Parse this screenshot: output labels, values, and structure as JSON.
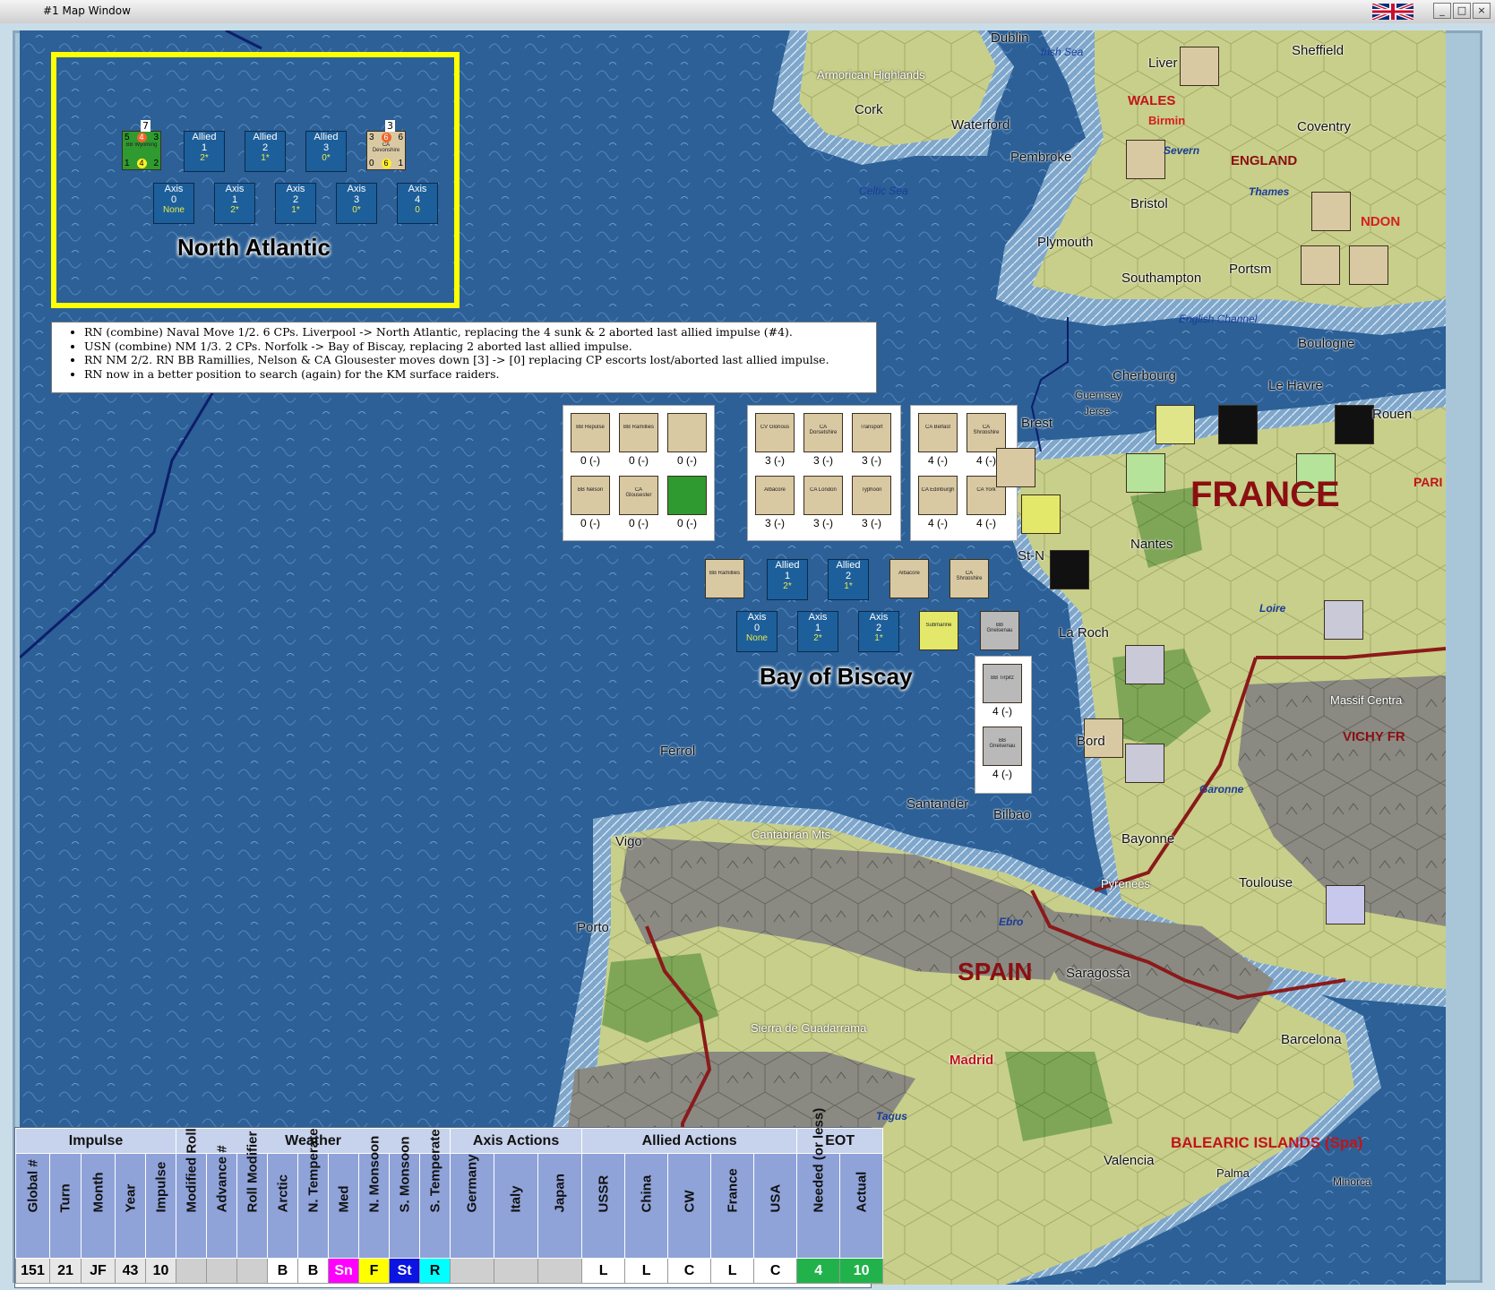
{
  "window": {
    "title": "#1 Map Window"
  },
  "map": {
    "seas": {
      "north_atlantic": "North Atlantic",
      "bay_of_biscay": "Bay of Biscay",
      "irish_sea": "Irish Sea",
      "celtic_sea": "Celtic Sea",
      "english_channel": "English Channel"
    },
    "cities": [
      "Dublin",
      "Cork",
      "Waterford",
      "Liver",
      "Sheffield",
      "Coventry",
      "Pembroke",
      "Bristol",
      "Plymouth",
      "Southampton",
      "Portsm",
      "Boulogne",
      "Cherbourg",
      "Le Havre",
      "Guernsey",
      "Jerse",
      "Brest",
      "Nantes",
      "St-N",
      "La Roch",
      "Bord",
      "Ferrol",
      "Vigo",
      "Porto",
      "Santander",
      "Bilbao",
      "Bayonne",
      "Toulouse",
      "Saragossa",
      "Barcelona",
      "Madrid",
      "Valencia",
      "Palma",
      "Minorca",
      "PARI",
      "Rouen"
    ],
    "regions": {
      "armorican": "Armorican Highlands",
      "cantabrian": "Cantabrian Mts",
      "pyrenees": "Pyrenees",
      "guadarrama": "Sierra de Guadarrama",
      "massif": "Massif Centra",
      "vichy": "VICHY FR"
    },
    "rivers": {
      "severn": "Severn",
      "thames": "Thames",
      "loire": "Loire",
      "garonne": "Garonne",
      "ebro": "Ebro",
      "tagus": "Tagus"
    },
    "countries": {
      "france": "FRANCE",
      "spain": "SPAIN",
      "england": "ENGLAND",
      "wales": "WALES",
      "london": "NDON",
      "birmingham": "Birmin",
      "balearic": "BALEARIC ISLANDS (Spa)"
    }
  },
  "north_atlantic_box": {
    "allied": [
      {
        "label": "Allied",
        "n": "1",
        "v": "2*"
      },
      {
        "label": "Allied",
        "n": "2",
        "v": "1*"
      },
      {
        "label": "Allied",
        "n": "3",
        "v": "0*"
      }
    ],
    "axis": [
      {
        "label": "Axis",
        "n": "0",
        "v": "None"
      },
      {
        "label": "Axis",
        "n": "1",
        "v": "2*"
      },
      {
        "label": "Axis",
        "n": "2",
        "v": "1*"
      },
      {
        "label": "Axis",
        "n": "3",
        "v": "0*"
      },
      {
        "label": "Axis",
        "n": "4",
        "v": "0"
      }
    ],
    "units": [
      {
        "name": "BB Wyoming",
        "stack": "7",
        "tl": "5",
        "tm": "4",
        "tr": "3",
        "bl": "1",
        "bm": "4",
        "br": "2"
      },
      {
        "name": "CA Devonshire",
        "stack": "3",
        "tl": "3",
        "tm": "6",
        "tr": "6",
        "bl": "0",
        "bm": "6",
        "br": "1"
      }
    ]
  },
  "notes": [
    "RN (combine) Naval Move 1/2.  6 CPs.  Liverpool -> North Atlantic, replacing the 4 sunk & 2 aborted last allied impulse (#4).",
    "USN (combine) NM 1/3.  2 CPs.  Norfolk -> Bay of Biscay, replacing 2 aborted last allied impulse.",
    "RN NM 2/2.  RN BB Ramillies, Nelson & CA Glousester moves down [3] -> [0] replacing CP escorts lost/aborted last allied impulse.",
    "RN now in a better position to search (again) for the KM surface raiders."
  ],
  "biscay_box": {
    "allied": [
      {
        "label": "Allied",
        "n": "1",
        "v": "2*"
      },
      {
        "label": "Allied",
        "n": "2",
        "v": "1*"
      }
    ],
    "axis": [
      {
        "label": "Axis",
        "n": "0",
        "v": "None"
      },
      {
        "label": "Axis",
        "n": "1",
        "v": "2*"
      },
      {
        "label": "Axis",
        "n": "2",
        "v": "1*"
      }
    ]
  },
  "stack_panels": {
    "panel1": [
      {
        "name": "BB Repulse",
        "cap": "0 (-)"
      },
      {
        "name": "BB Ramillies",
        "cap": "0 (-)"
      },
      {
        "name": "",
        "cap": "0 (-)"
      },
      {
        "name": "BB Nelson",
        "cap": "0 (-)"
      },
      {
        "name": "CA Glousester",
        "cap": "0 (-)"
      },
      {
        "name": "",
        "cap": "0 (-)"
      }
    ],
    "panel2": [
      {
        "name": "CV Glorious",
        "cap": "3 (-)"
      },
      {
        "name": "CA Dorsetshire",
        "cap": "3 (-)"
      },
      {
        "name": "Transport",
        "cap": "3 (-)"
      },
      {
        "name": "Albacore",
        "cap": "3 (-)"
      },
      {
        "name": "CA London",
        "cap": "3 (-)"
      },
      {
        "name": "Typhoon",
        "cap": "3 (-)"
      }
    ],
    "panel3": [
      {
        "name": "CA Belfast",
        "cap": "4 (-)"
      },
      {
        "name": "CA Shropshire",
        "cap": "4 (-)"
      },
      {
        "name": "CA Edinburgh",
        "cap": "4 (-)"
      },
      {
        "name": "CA York",
        "cap": "4 (-)"
      }
    ],
    "panel4": [
      {
        "name": "BB Tirpitz",
        "cap": "4 (-)"
      },
      {
        "name": "BB Gneisenau",
        "cap": "4 (-)"
      }
    ]
  },
  "hud": {
    "groups": {
      "impulse": "Impulse",
      "weather": "Weather",
      "axis": "Axis Actions",
      "allied": "Allied Actions",
      "eot": "EOT"
    },
    "headers": [
      "Global #",
      "Turn",
      "Month",
      "Year",
      "Impulse",
      "Modified Roll",
      "Advance #",
      "Roll Modifier",
      "Arctic",
      "N. Temperate",
      "Med",
      "N. Monsoon",
      "S. Monsoon",
      "S. Temperate",
      "Germany",
      "Italy",
      "Japan",
      "USSR",
      "China",
      "CW",
      "France",
      "USA",
      "Needed (or less)",
      "Actual"
    ],
    "values": [
      "151",
      "21",
      "JF",
      "43",
      "10",
      "",
      "",
      "",
      "B",
      "B",
      "Sn",
      "F",
      "St",
      "R",
      "",
      "",
      "",
      "L",
      "L",
      "C",
      "L",
      "C",
      "4",
      "10"
    ]
  },
  "colors": {
    "sea": "#2c6096",
    "land": "#c9cf8c",
    "mountain": "#8b8b85",
    "border": "#8b1a1a",
    "highlight": "#ffff00"
  }
}
